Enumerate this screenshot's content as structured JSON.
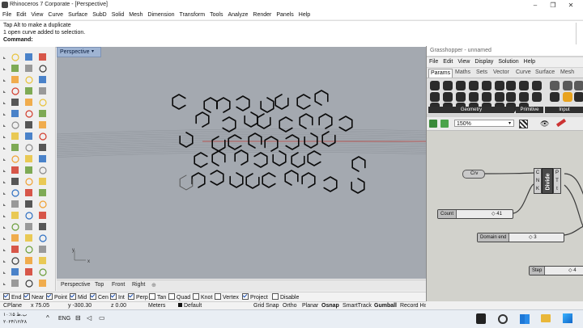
{
  "window": {
    "title": "Rhinoceros 7 Corporate - [Perspective]"
  },
  "menu": [
    "File",
    "Edit",
    "View",
    "Curve",
    "Surface",
    "SubD",
    "Solid",
    "Mesh",
    "Dimension",
    "Transform",
    "Tools",
    "Analyze",
    "Render",
    "Panels",
    "Help"
  ],
  "command": {
    "history": [
      "Tap Alt to make a duplicate",
      "1 open curve added to selection."
    ],
    "prompt": "Command:"
  },
  "viewport": {
    "name": "Perspective",
    "menu_arrow": "▾",
    "axis_y": "y",
    "axis_x": "x"
  },
  "viewport_tabs": [
    "Perspective",
    "Top",
    "Front",
    "Right"
  ],
  "viewport_tabs_add": "⊕",
  "osnaps": [
    {
      "label": "End",
      "checked": true
    },
    {
      "label": "Near",
      "checked": true
    },
    {
      "label": "Point",
      "checked": true
    },
    {
      "label": "Mid",
      "checked": true
    },
    {
      "label": "Cen",
      "checked": true
    },
    {
      "label": "Int",
      "checked": true
    },
    {
      "label": "Perp",
      "checked": true
    },
    {
      "label": "Tan",
      "checked": false
    },
    {
      "label": "Quad",
      "checked": false
    },
    {
      "label": "Knot",
      "checked": false
    },
    {
      "label": "Vertex",
      "checked": false
    },
    {
      "label": "Project",
      "checked": true
    },
    {
      "label": "Disable",
      "checked": false
    }
  ],
  "status": {
    "cplane": "CPlane",
    "x": "x 75.05",
    "y": "y -300.30",
    "z": "z 0.00",
    "units": "Meters",
    "layer": "Default",
    "toggles": [
      "Grid Snap",
      "Ortho",
      "Planar",
      "Osnap",
      "SmartTrack",
      "Gumball",
      "Record History"
    ]
  },
  "grasshopper": {
    "title": "Grasshopper - unnamed",
    "menu": [
      "File",
      "Edit",
      "View",
      "Display",
      "Solution",
      "Help"
    ],
    "tabs": [
      "Params",
      "Maths",
      "Sets",
      "Vector",
      "Curve",
      "Surface",
      "Mesh"
    ],
    "active_tab": "Params",
    "ribbon_groups": [
      "Geometry",
      "Primitive",
      "Input"
    ],
    "zoom": "150%",
    "nodes": {
      "crv": "Crv",
      "divide": {
        "title": "Divide",
        "inputs": [
          "C",
          "N",
          "K"
        ],
        "outputs": [
          "P",
          "T",
          "t"
        ]
      }
    },
    "sliders": [
      {
        "label": "Count",
        "value": "41"
      },
      {
        "label": "Domain end",
        "value": "3"
      },
      {
        "label": "Step",
        "value": "4"
      }
    ]
  },
  "taskbar": {
    "lang": "ENG",
    "time": "۱۰:۱۵ ب.ظ",
    "date": "۲۰۲۴/۱۲/۲۸"
  },
  "colors": {
    "viewport_bg": "#a4a9b0",
    "active_tab": "#9fb4d3",
    "gh_canvas": "#d2d2cc",
    "curve": "#0a0a0a"
  }
}
